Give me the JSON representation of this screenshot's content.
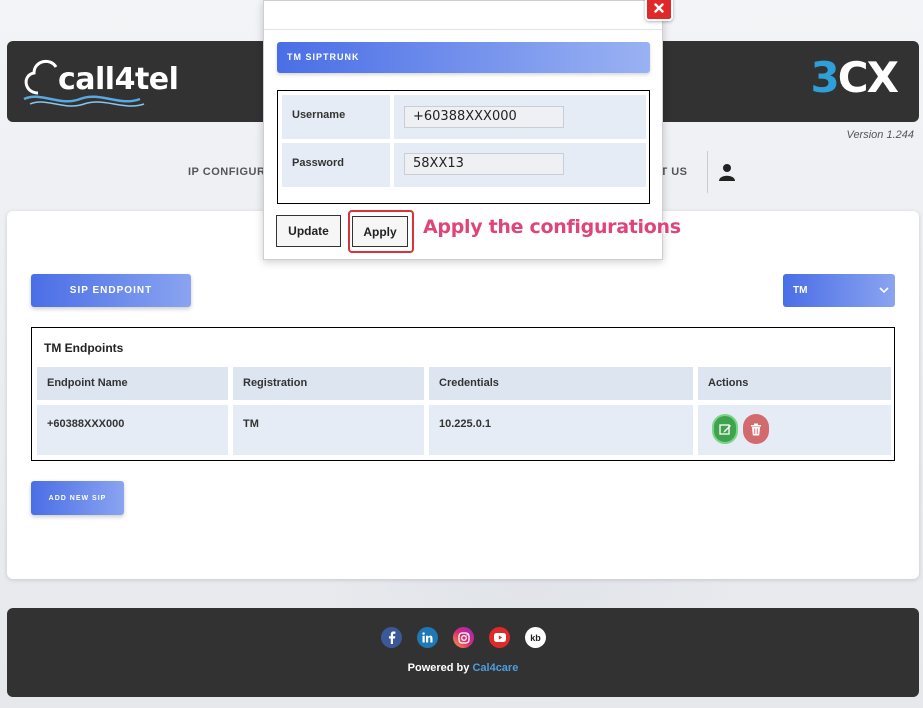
{
  "header": {
    "logo_left_text": "call4tel",
    "logo_right_prefix": "3",
    "logo_right_suffix": "CX",
    "version": "Version 1.244"
  },
  "nav": {
    "item_left": "IP CONFIGUR",
    "item_right": "CT US"
  },
  "main": {
    "sip_endpoint_button": "SIP ENDPOINT",
    "provider_select": {
      "selected": "TM"
    },
    "table": {
      "title": "TM Endpoints",
      "columns": [
        "Endpoint Name",
        "Registration",
        "Credentials",
        "Actions"
      ],
      "rows": [
        {
          "endpoint_name": "+60388XXX000",
          "registration": "TM",
          "credentials": "10.225.0.1"
        }
      ]
    },
    "add_new_sip_button": "ADD NEW SIP"
  },
  "footer": {
    "social_icons": [
      "facebook-icon",
      "linkedin-icon",
      "instagram-icon",
      "youtube-icon",
      "kb-icon"
    ],
    "kb_label": "kb",
    "powered_prefix": "Powered by ",
    "powered_brand": "Cal4care"
  },
  "modal": {
    "title": "TM SIPTRUNK",
    "username_label": "Username",
    "username_value": "+60388XXX000",
    "password_label": "Password",
    "password_value": "58XX13",
    "update_button": "Update",
    "apply_button": "Apply",
    "annotation": "Apply the configurations"
  },
  "colors": {
    "accent_gradient_start": "#4a6ee6",
    "accent_gradient_end": "#8aa4f0",
    "header_bg": "#323232",
    "close_red": "#e0282b",
    "annotation_pink": "#e0457a",
    "edit_green": "#3fa34d",
    "delete_red": "#d26a6e"
  }
}
